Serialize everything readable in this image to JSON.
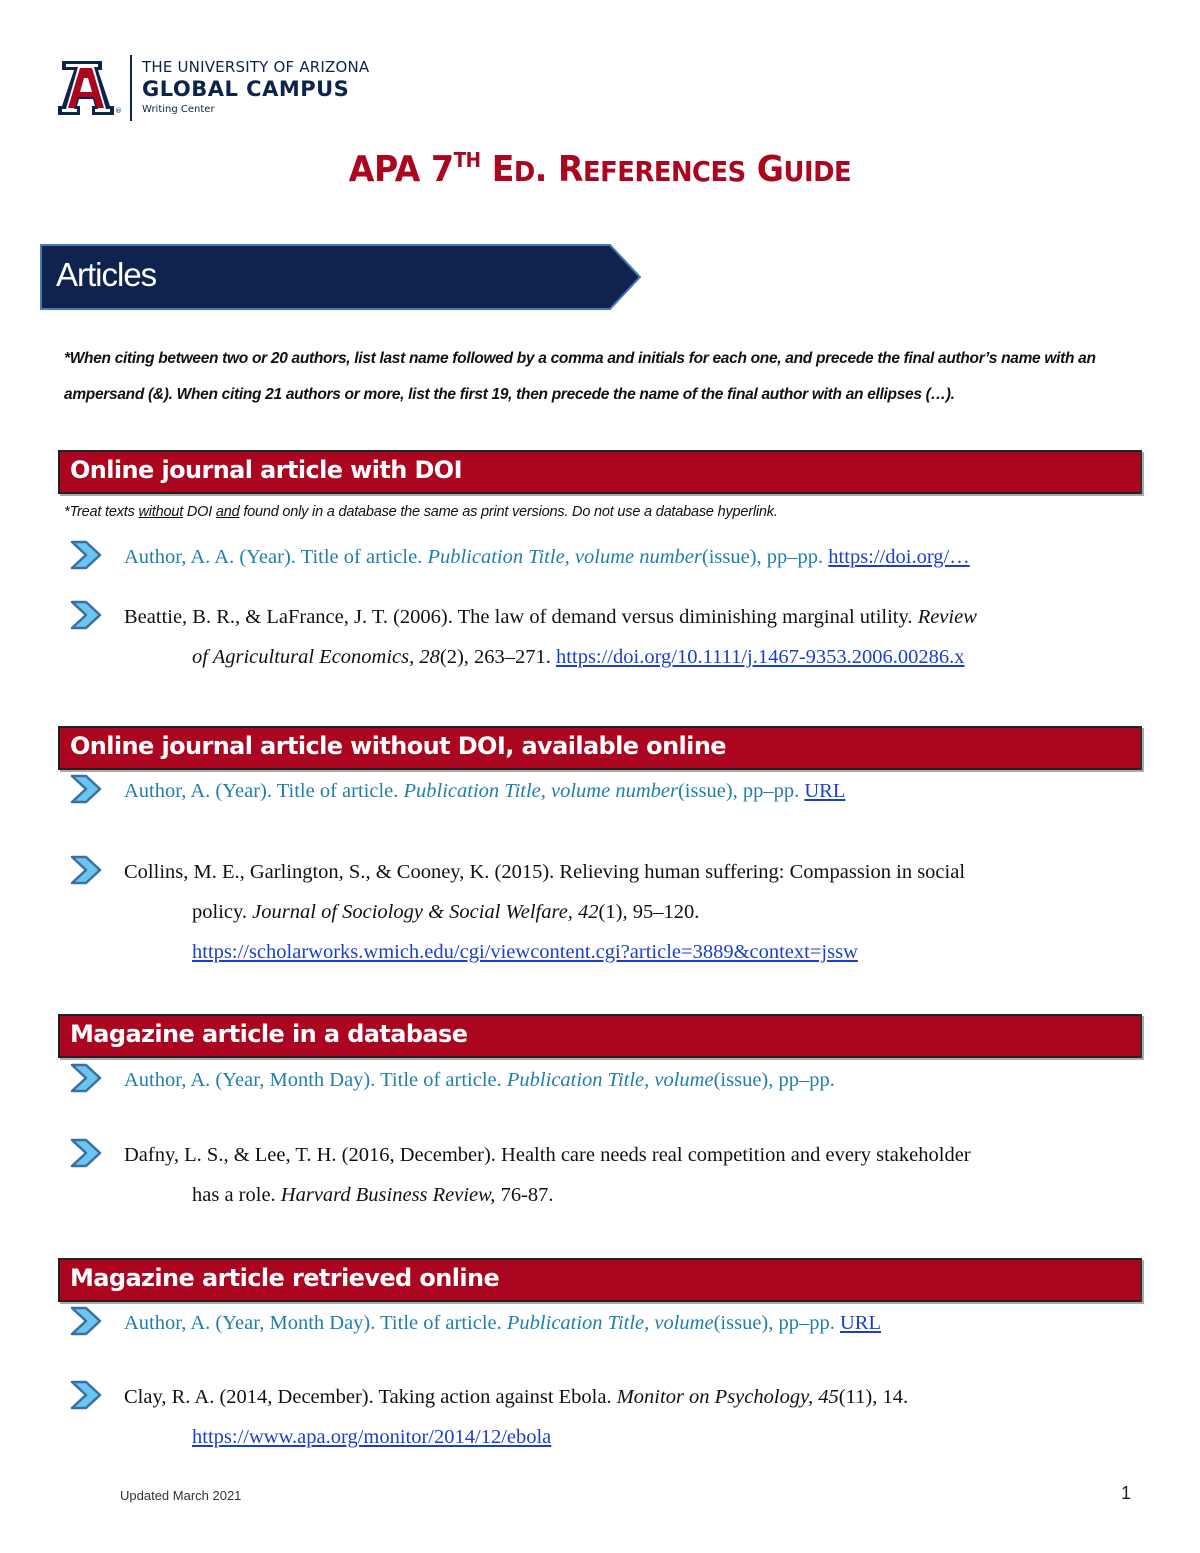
{
  "logo": {
    "line1": "THE UNIVERSITY OF ARIZONA",
    "line2": "GLOBAL CAMPUS",
    "line3": "Writing Center",
    "registered": "®",
    "icon": "university-a-logo-icon"
  },
  "title": {
    "part1": "APA 7",
    "sup": "TH",
    "part2_big": " E",
    "part2_small": "D",
    "part3": ". R",
    "part4_small": "EFERENCES",
    "part5": " G",
    "part6_small": "UIDE",
    "full_text": "APA 7TH ED. REFERENCES GUIDE"
  },
  "banner": {
    "label": "Articles"
  },
  "intro_note": "*When citing between two or 20 authors, list last name followed by a comma and initials for each one, and precede the final author’s name with an ampersand (&). When citing 21 authors or more, list the first 19, then precede the name of the final author with an ellipses (…).",
  "colors": {
    "brand_red": "#ab0520",
    "brand_navy": "#0c234b",
    "template_blue": "#1f7fab",
    "link_blue": "#1a3fcc",
    "chevron_fill": "#6ac6ee"
  },
  "sections": [
    {
      "header": "Online journal article with DOI",
      "note": {
        "pre": "*Treat texts ",
        "u1": "without",
        "mid1": " DOI ",
        "u2": "and",
        "post": " found only in a database the same as print versions. Do not use a database hyperlink."
      },
      "template": {
        "plain1": "Author, A. A. (Year). Title of article. ",
        "italic": "Publication Title, volume number",
        "plain2": "(issue), pp–pp. ",
        "link": "https://doi.org/…"
      },
      "example": {
        "plain1": "Beattie, B. R., & LaFrance, J. T. (2006). The law of demand versus diminishing marginal utility. ",
        "italic1": "Review",
        "line2_italic": "of Agricultural Economics",
        "line2_plain1": ", ",
        "line2_italic2": "28",
        "line2_plain2": "(2), 263–271. ",
        "link": "https://doi.org/10.1111/j.1467-9353.2006.00286.x"
      }
    },
    {
      "header": "Online journal article without DOI, available online",
      "template": {
        "plain1": "Author, A. (Year). Title of article. ",
        "italic": "Publication Title, volume number",
        "plain2": "(issue), pp–pp. ",
        "link": "URL"
      },
      "example": {
        "plain1": "Collins, M. E., Garlington, S., & Cooney, K. (2015). Relieving human suffering: Compassion in social",
        "line2_plain": "policy. ",
        "line2_italic": "Journal of Sociology & Social Welfare, 42",
        "line2_plain2": "(1), 95–120.",
        "link": "https://scholarworks.wmich.edu/cgi/viewcontent.cgi?article=3889&context=jssw"
      }
    },
    {
      "header": "Magazine article in a database",
      "template": {
        "plain1": "Author, A. (Year, Month Day). Title of article. ",
        "italic": "Publication Title, volume",
        "plain2": "(issue), pp–pp."
      },
      "example": {
        "plain1": "Dafny, L. S., & Lee, T. H. (2016, December). Health care needs real competition and every stakeholder",
        "line2_plain": "has a role. ",
        "line2_italic": "Harvard Business Review,",
        "line2_plain2": " 76-87."
      }
    },
    {
      "header": "Magazine article retrieved online",
      "template": {
        "plain1": "Author, A. (Year, Month Day). Title of article. ",
        "italic": "Publication Title, volume",
        "plain2": "(issue), pp–pp. ",
        "link": "URL"
      },
      "example": {
        "plain1": "Clay, R. A. (2014, December). Taking action against Ebola. ",
        "italic": "Monitor on Psychology, 45",
        "plain2": "(11), 14.",
        "link": "https://www.apa.org/monitor/2014/12/ebola"
      }
    }
  ],
  "footer": {
    "updated": "Updated March 2021",
    "page_number": "1"
  }
}
